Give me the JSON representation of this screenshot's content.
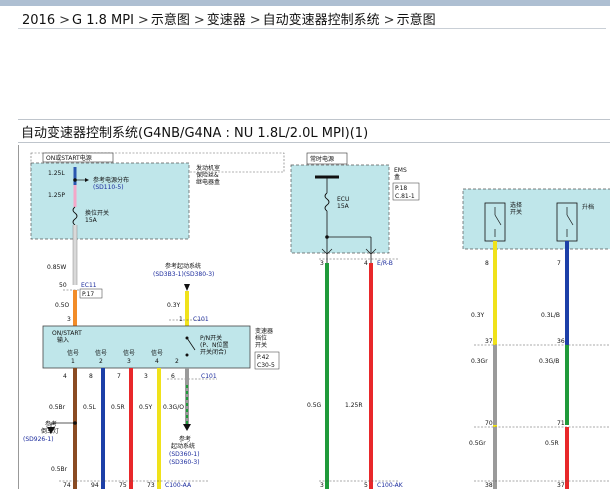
{
  "breadcrumb": {
    "items": [
      "2016",
      "G 1.8 MPI",
      "示意图",
      "变速器",
      "自动变速器控制系统",
      "示意图"
    ],
    "separator": ">"
  },
  "title": "自动变速器控制系统(G4NB/G4NA : NU 1.8L/2.0L MPI)(1)",
  "diagram": {
    "left_box": {
      "header": "ON或START电源",
      "fuse_top": "1.25L",
      "fuse_pink": "1.25P",
      "ref_power": "参考电源分布",
      "ref_power_code": "(SD110-5)",
      "fuse_name": "换位开关",
      "fuse_amp": "15A",
      "side_label_1": "发动机室",
      "side_label_2": "保险丝&",
      "side_label_3": "继电器盒"
    },
    "wire_labels": {
      "w085": "0.85W",
      "w50": "50",
      "ec11": "EC11",
      "p17": "P.17",
      "w05o": "0.5O",
      "w3": "3",
      "start_ref": "参考起动系统",
      "start_ref_code": "(SD3B3-1)(SD380-3)",
      "w03y": "0.3Y",
      "w1": "1",
      "c101": "C101"
    },
    "switch_box": {
      "on_start": "ON/START",
      "input": "输入",
      "pn_1": "P/N开关",
      "pn_2": "(P、N位置",
      "pn_3": "开关闭合)",
      "right_1": "变速器",
      "right_2": "档位",
      "right_3": "开关",
      "p42": "P.42",
      "c30": "C30-5",
      "signal": "信号",
      "sig_nums": [
        "2",
        "1",
        "3",
        "4"
      ],
      "sig_label_nums": [
        "1",
        "2",
        "3",
        "4"
      ]
    },
    "lower": {
      "pins_top": [
        "4",
        "8",
        "7",
        "3",
        "6",
        "2"
      ],
      "c101": "C101",
      "sizes": [
        "0.5Br",
        "0.5L",
        "0.5R",
        "0.5Y",
        "0.3G/O"
      ],
      "ref_rev_1": "参考",
      "ref_rev_2": "倒车灯",
      "ref_rev_code": "(SD926-1)",
      "ref_start_1": "参考",
      "ref_start_2": "起动系统",
      "ref_start_code_1": "(SD360-1)",
      "ref_start_code_2": "(SD360-3)",
      "br05": "0.5Br",
      "pins_bottom": [
        "74",
        "94",
        "75",
        "73"
      ],
      "c100aa": "C100-AA"
    },
    "ems": {
      "header": "常时电源",
      "ems_1": "EMS",
      "ems_2": "盒",
      "p18": "P.18",
      "c81": "C.81-1",
      "ecu": "ECU",
      "amp": "15A",
      "pin3": "3",
      "pin4": "4",
      "erb": "E/R-B",
      "g05": "0.5G",
      "r125": "1.25R",
      "pin_b3": "3",
      "pin_b5": "5",
      "c100ak": "C100-AK"
    },
    "right_box": {
      "sw1_1": "选择",
      "sw1_2": "开关",
      "sw2": "升档",
      "pin8": "8",
      "pin7": "7",
      "y03": "0.3Y",
      "lb03": "0.3L/B",
      "p37": "37",
      "p36": "36",
      "gr03": "0.3Gr",
      "gb03": "0.3G/B",
      "p70": "70",
      "p71": "71",
      "gr05": "0.5Gr",
      "r05": "0.5R",
      "p38": "38",
      "p37b": "37"
    }
  },
  "colors": {
    "box_fill": "#bfe6ea",
    "wire_white": "#e8e8e8",
    "wire_pink": "#f4a7c8",
    "wire_orange": "#f28c28",
    "wire_yellow": "#f0e21a",
    "wire_green": "#1f9a3a",
    "wire_red": "#e8282a",
    "wire_blue": "#1c3fa8",
    "wire_brown": "#8a4b22",
    "wire_gray": "#9a9a9a",
    "label_blue": "#1a2a9c"
  }
}
